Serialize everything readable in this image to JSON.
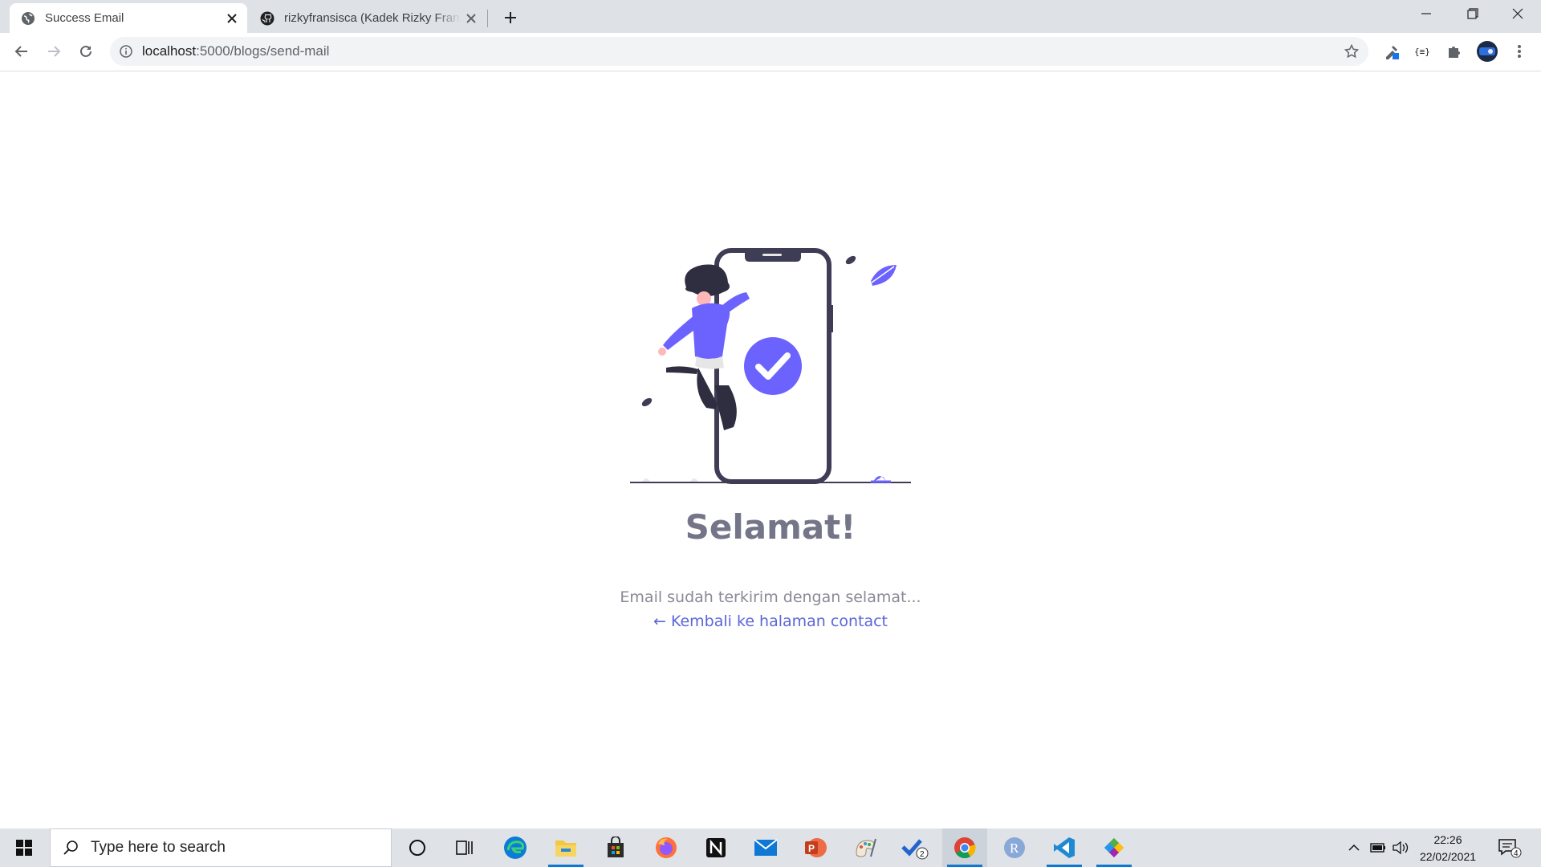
{
  "browser": {
    "tabs": [
      {
        "title": "Success Email",
        "active": true,
        "favicon": "globe-icon"
      },
      {
        "title": "rizkyfransisca (Kadek Rizky Fransisca)",
        "active": false,
        "favicon": "github-icon"
      }
    ],
    "url": {
      "host": "localhost",
      "path": ":5000/blogs/send-mail"
    }
  },
  "page": {
    "heading": "Selamat!",
    "message": "Email sudah terkirim dengan selamat...",
    "back_link": "← Kembali ke halaman contact",
    "accent_color": "#6c63ff"
  },
  "taskbar": {
    "search_placeholder": "Type here to search",
    "apps": [
      "cortana-icon",
      "task-view-icon",
      "edge-icon",
      "file-explorer-icon",
      "store-icon",
      "firefox-icon",
      "notion-icon",
      "mail-icon",
      "powerpoint-icon",
      "paint-icon",
      "todo-icon",
      "chrome-icon",
      "r-icon",
      "vscode-icon",
      "git-icon"
    ],
    "todo_badge": "2",
    "notification_count": "4",
    "time": "22:26",
    "date": "22/02/2021"
  }
}
